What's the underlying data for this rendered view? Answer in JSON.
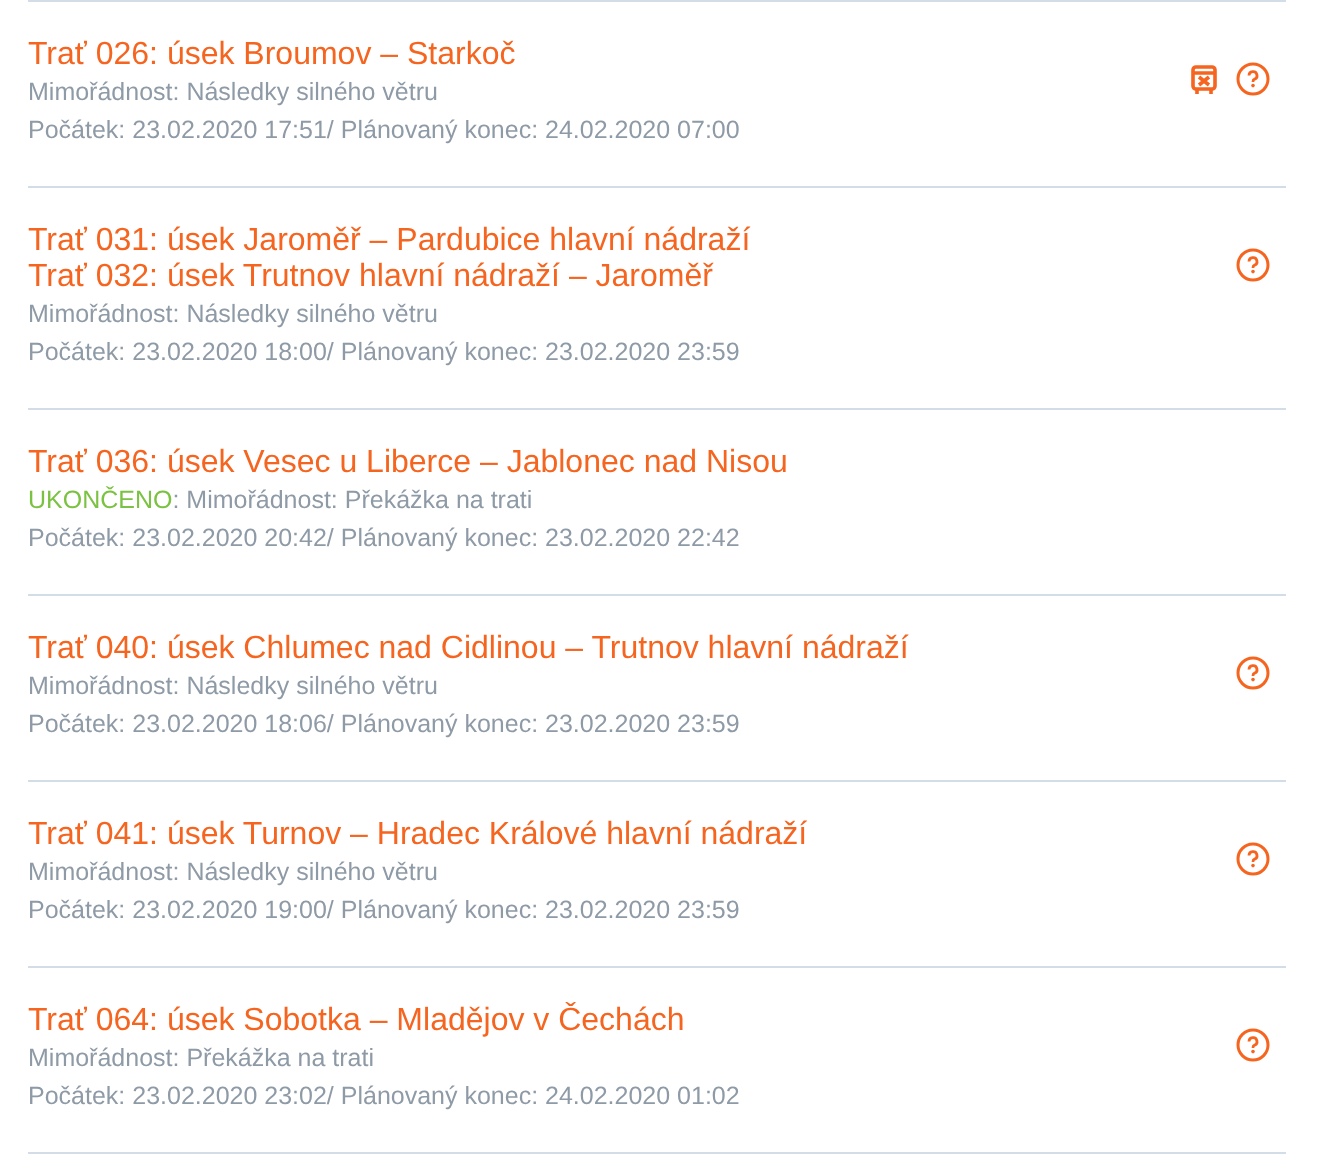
{
  "disruptions": [
    {
      "titles": [
        "Trať 026: úsek Broumov – Starkoč"
      ],
      "type": "Mimořádnost: Následky silného větru",
      "times": "Počátek: 23.02.2020 17:51/ Plánovaný konec: 24.02.2020 07:00",
      "icons": [
        {
          "kind": "bus"
        },
        {
          "kind": "help"
        }
      ]
    },
    {
      "titles": [
        "Trať 031: úsek Jaroměř – Pardubice hlavní nádraží",
        "Trať 032: úsek Trutnov hlavní nádraží – Jaroměř"
      ],
      "type": "Mimořádnost: Následky silného větru",
      "times": "Počátek: 23.02.2020 18:00/ Plánovaný konec: 23.02.2020 23:59",
      "icons": [
        {
          "kind": "help"
        }
      ]
    },
    {
      "titles": [
        "Trať 036: úsek Vesec u Liberce – Jablonec nad Nisou"
      ],
      "status": "UKONČENO",
      "type": ": Mimořádnost: Překážka na trati",
      "times": "Počátek: 23.02.2020 20:42/ Plánovaný konec: 23.02.2020 22:42"
    },
    {
      "titles": [
        "Trať 040: úsek Chlumec nad Cidlinou – Trutnov hlavní nádraží"
      ],
      "type": "Mimořádnost: Následky silného větru",
      "times": "Počátek: 23.02.2020 18:06/ Plánovaný konec: 23.02.2020 23:59",
      "icons": [
        {
          "kind": "help"
        }
      ]
    },
    {
      "titles": [
        "Trať 041: úsek Turnov – Hradec Králové hlavní nádraží"
      ],
      "type": "Mimořádnost: Následky silného větru",
      "times": "Počátek: 23.02.2020 19:00/ Plánovaný konec: 23.02.2020 23:59",
      "icons": [
        {
          "kind": "help"
        }
      ]
    },
    {
      "titles": [
        "Trať 064: úsek Sobotka – Mladějov v Čechách"
      ],
      "type": "Mimořádnost: Překážka na trati",
      "times": "Počátek: 23.02.2020 23:02/ Plánovaný konec: 24.02.2020 01:02",
      "icons": [
        {
          "kind": "help"
        }
      ]
    }
  ]
}
